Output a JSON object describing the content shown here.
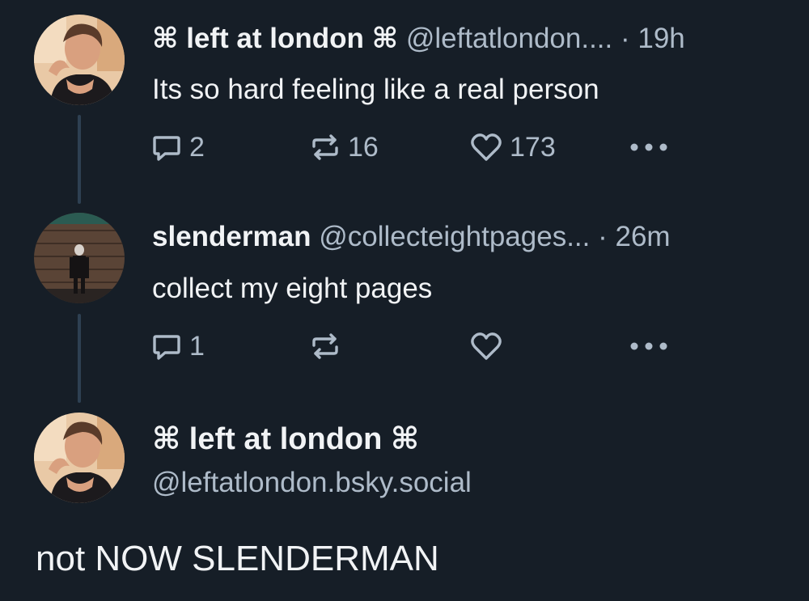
{
  "posts": [
    {
      "display_name": "⌘ left at london ⌘",
      "handle": "@leftatlondon....",
      "separator": "·",
      "time": "19h",
      "text": "Its so hard feeling like a real person",
      "reply_count": "2",
      "repost_count": "16",
      "like_count": "173"
    },
    {
      "display_name": "slenderman",
      "handle": "@collecteightpages...",
      "separator": "·",
      "time": "26m",
      "text": "collect my eight pages",
      "reply_count": "1",
      "repost_count": "",
      "like_count": ""
    }
  ],
  "main_post": {
    "display_name": "⌘ left at london ⌘",
    "handle": "@leftatlondon.bsky.social",
    "text": "not NOW SLENDERMAN"
  },
  "icons": {
    "reply": "speech-bubble-icon",
    "repost": "repost-arrows-icon",
    "like": "heart-icon",
    "more": "more-dots-icon"
  },
  "colors": {
    "background": "#161e27",
    "muted_text": "#aebbc9",
    "thread_line": "#2e4052"
  }
}
